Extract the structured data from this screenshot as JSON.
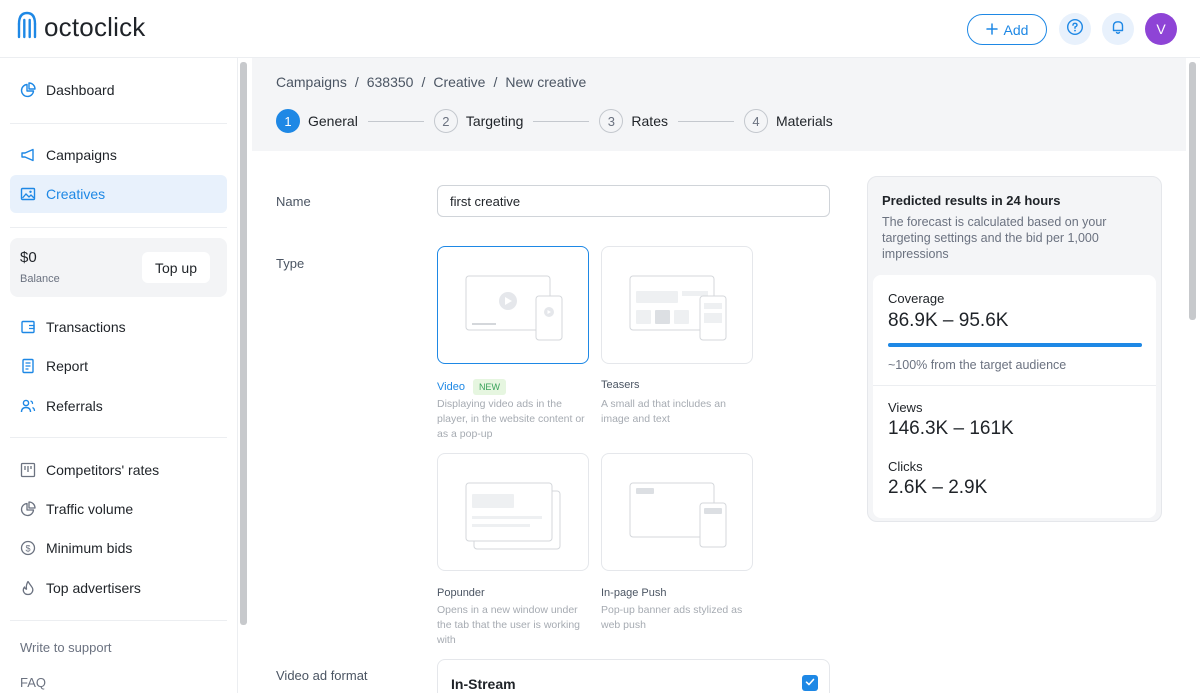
{
  "header": {
    "logo_text": "octoclick",
    "add_label": "Add",
    "avatar_letter": "V"
  },
  "sidebar": {
    "items": [
      {
        "label": "Dashboard",
        "icon": "pie-chart-icon"
      },
      {
        "label": "Campaigns",
        "icon": "megaphone-icon"
      },
      {
        "label": "Creatives",
        "icon": "image-icon",
        "active": true
      },
      {
        "label": "Transactions",
        "icon": "wallet-icon"
      },
      {
        "label": "Report",
        "icon": "document-icon"
      },
      {
        "label": "Referrals",
        "icon": "users-icon"
      },
      {
        "label": "Competitors' rates",
        "icon": "columns-icon"
      },
      {
        "label": "Traffic volume",
        "icon": "pie-chart-icon"
      },
      {
        "label": "Minimum bids",
        "icon": "dollar-circle-icon"
      },
      {
        "label": "Top advertisers",
        "icon": "flame-icon"
      }
    ],
    "balance": {
      "amount": "$0",
      "label": "Balance",
      "topup_label": "Top up"
    },
    "links": [
      "Write to support",
      "FAQ"
    ]
  },
  "breadcrumb": [
    "Campaigns",
    "638350",
    "Creative",
    "New creative"
  ],
  "breadcrumb_sep": "/",
  "steps": [
    {
      "num": "1",
      "label": "General",
      "active": true
    },
    {
      "num": "2",
      "label": "Targeting"
    },
    {
      "num": "3",
      "label": "Rates"
    },
    {
      "num": "4",
      "label": "Materials"
    }
  ],
  "form": {
    "name_label": "Name",
    "name_value": "first creative",
    "type_label": "Type",
    "types": [
      {
        "title": "Video",
        "badge": "NEW",
        "desc": "Displaying video ads in the player, in the website content or as a pop-up",
        "selected": true
      },
      {
        "title": "Teasers",
        "desc": "A small ad that includes an image and text"
      },
      {
        "title": "Popunder",
        "desc": "Opens in a new window under the tab that the user is working with"
      },
      {
        "title": "In-page Push",
        "desc": "Pop-up banner ads stylized as web push"
      }
    ],
    "video_format_label": "Video ad format",
    "video_format_option": "In-Stream"
  },
  "forecast": {
    "title": "Predicted results in 24 hours",
    "desc": "The forecast is calculated based on your targeting settings and the bid per 1,000 impressions",
    "coverage_label": "Coverage",
    "coverage_value": "86.9K – 95.6K",
    "coverage_fill": 1.0,
    "coverage_note": "~100% from the target audience",
    "views_label": "Views",
    "views_value": "146.3K – 161K",
    "clicks_label": "Clicks",
    "clicks_value": "2.6K – 2.9K"
  },
  "colors": {
    "accent": "#1e88e5",
    "avatar": "#8e44d6",
    "new_badge": "#3aa35b"
  }
}
